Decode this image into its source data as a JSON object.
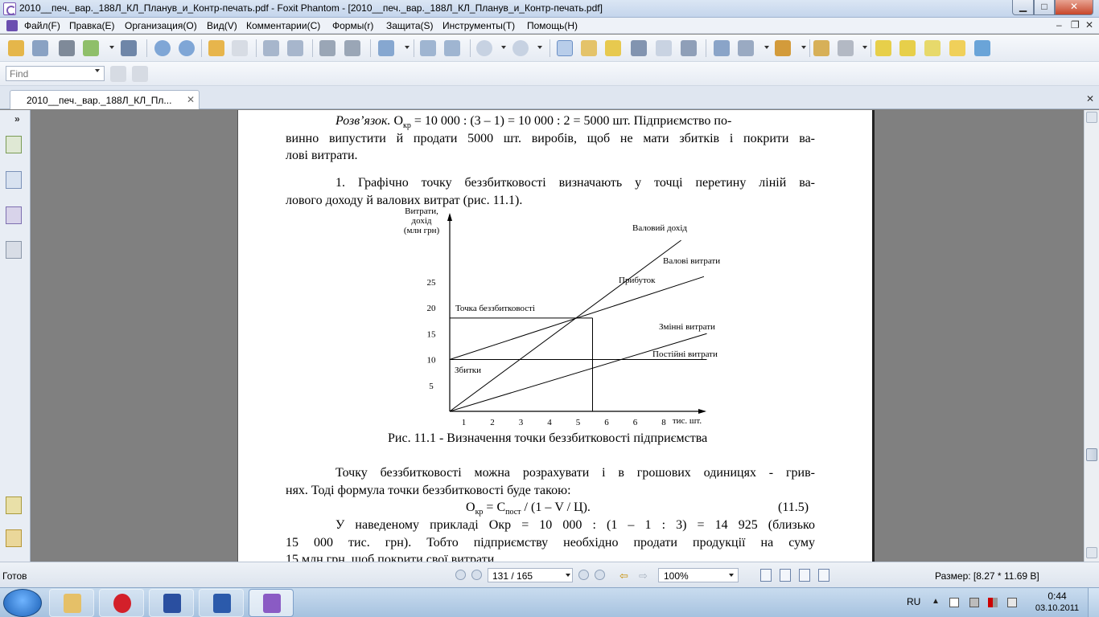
{
  "window": {
    "title": "2010__печ._вар._188Л_КЛ_Планув_и_Контр-печать.pdf - Foxit Phantom - [2010__печ._вар._188Л_КЛ_Планув_и_Контр-печать.pdf]",
    "min": "▁",
    "max": "□",
    "close": "✕"
  },
  "menubar": {
    "items": [
      "Файл(F)",
      "Правка(E)",
      "Организация(O)",
      "Вид(V)",
      "Комментарии(C)",
      "Формы(r)",
      "Защита(S)",
      "Инструменты(T)",
      "Помощь(H)"
    ],
    "mdi_min": "–",
    "mdi_max": "❐",
    "mdi_close": "✕"
  },
  "findbar": {
    "placeholder": "Find"
  },
  "tabs": {
    "active_label": "2010__печ._вар._188Л_КЛ_Пл...",
    "close": "✕",
    "close_all": "✕"
  },
  "leftpanel": {
    "collapse": "»"
  },
  "document": {
    "para1_line1_a": "Розв’язок.",
    "para1_line1_b": " О",
    "para1_line1_sub": "кр",
    "para1_line1_c": " = 10 000 : (3 – 1) = 10 000 : 2 = 5000 шт. Підприємство по-",
    "para1_line2": "винно випустити й продати 5000 шт. виробів, щоб не мати збитків і покрити ва-",
    "para1_line3": "лові витрати.",
    "para2_line1": "1. Графічно точку беззбитковості визначають у точці перетину ліній ва-",
    "para2_line2": "лового доходу й валових витрат (рис. 11.1).",
    "caption": "Рис. 11.1 - Визначення точки беззбитковості підприємства",
    "para3_line1": "Точку беззбитковості можна розрахувати і в грошових одиницях - грив-",
    "para3_line2": "нях. Тоді формула точки беззбитковості буде такою:",
    "formula_a": "О",
    "formula_sub1": "кр",
    "formula_b": " = С",
    "formula_sub2": "пост",
    "formula_c": " / (1 – V / Ц).",
    "formula_number": "(11.5)",
    "para4_line1": "У наведеному прикладі Окр = 10 000 : (1 – 1 : 3) = 14 925 (близько",
    "para4_line2": "15 000 тис. грн). Тобто підприємству необхідно продати продукції на суму",
    "para4_line3": "15 млн грн, щоб покрити свої витрати."
  },
  "chart_data": {
    "type": "line",
    "ylabel_lines": [
      "Витрати,",
      "дохід",
      "(млн грн)"
    ],
    "xlabel": "тис. шт.",
    "x_ticks": [
      "1",
      "2",
      "3",
      "4",
      "5",
      "6",
      "6",
      "8"
    ],
    "y_ticks": [
      "5",
      "10",
      "15",
      "20",
      "25"
    ],
    "series": [
      {
        "name": "Валовий дохід",
        "x": [
          0,
          8.1
        ],
        "y": [
          0,
          33
        ]
      },
      {
        "name": "Валові витрати",
        "x": [
          0,
          8.9
        ],
        "y": [
          10,
          26
        ]
      },
      {
        "name": "Змінні витрати",
        "x": [
          0,
          9.0
        ],
        "y": [
          0,
          15
        ]
      },
      {
        "name": "Постійні витрати",
        "x": [
          0,
          9.0
        ],
        "y": [
          10,
          10
        ]
      }
    ],
    "annotations": [
      {
        "text": "Точка беззбитковості",
        "x": 5,
        "y": 18
      },
      {
        "text": "Прибуток"
      },
      {
        "text": "Збитки"
      }
    ],
    "xlim": [
      0,
      9.0
    ],
    "ylim": [
      0,
      33
    ]
  },
  "statusbar": {
    "ready": "Готов",
    "page": "131 / 165",
    "zoom": "100%",
    "size": "Размер: [8.27 * 11.69 В]"
  },
  "taskbar": {
    "lang": "RU",
    "time": "0:44",
    "date": "03.10.2011"
  }
}
